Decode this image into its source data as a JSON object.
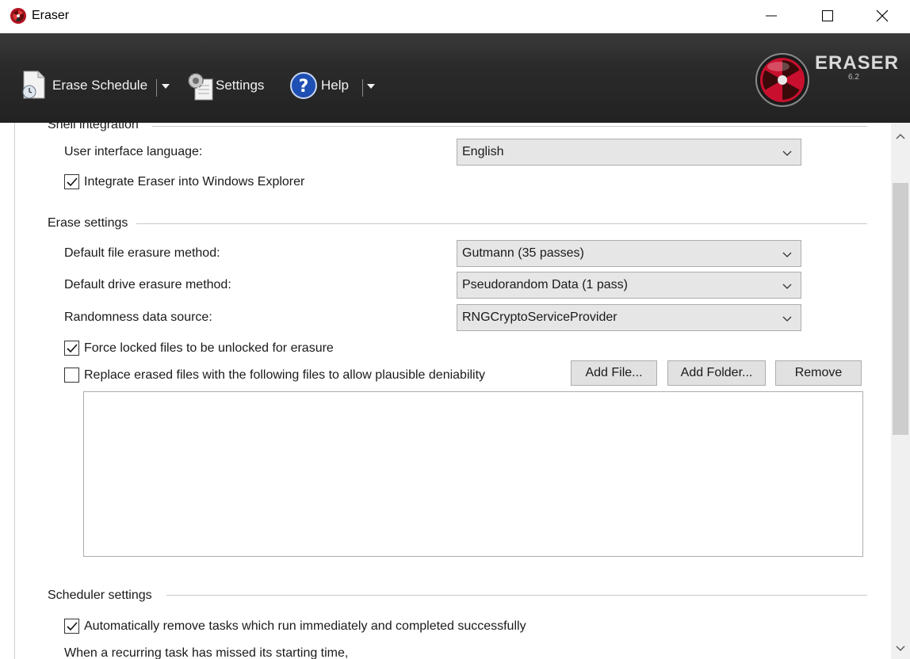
{
  "window": {
    "title": "Eraser",
    "minimize_icon": "minimize-icon",
    "maximize_icon": "maximize-icon",
    "close_icon": "close-icon"
  },
  "toolbar": {
    "erase_schedule_label": "Erase Schedule",
    "settings_label": "Settings",
    "help_label": "Help",
    "brand_name": "ERASER",
    "brand_version": "6.2"
  },
  "shell_integration": {
    "group_title": "Shell integration",
    "language_label": "User interface language:",
    "language_value": "English",
    "integrate_label": "Integrate Eraser into Windows Explorer",
    "integrate_checked": true
  },
  "erase_settings": {
    "group_title": "Erase settings",
    "file_method_label": "Default file erasure method:",
    "file_method_value": "Gutmann (35 passes)",
    "drive_method_label": "Default drive erasure method:",
    "drive_method_value": "Pseudorandom Data (1 pass)",
    "random_source_label": "Randomness data source:",
    "random_source_value": "RNGCryptoServiceProvider",
    "force_unlock_label": "Force locked files to be unlocked for erasure",
    "force_unlock_checked": true,
    "plausible_label": "Replace erased files with the following files to allow plausible deniability",
    "plausible_checked": false,
    "add_file_label": "Add File...",
    "add_folder_label": "Add Folder...",
    "remove_label": "Remove"
  },
  "scheduler_settings": {
    "group_title": "Scheduler settings",
    "auto_remove_label": "Automatically remove tasks which run immediately and completed successfully",
    "auto_remove_checked": true,
    "missed_label": "When a recurring task has missed its starting time,"
  },
  "colors": {
    "toolbar_bg": "#2b2b2b",
    "logo_red": "#c8102e",
    "help_blue": "#1e4fb3"
  }
}
